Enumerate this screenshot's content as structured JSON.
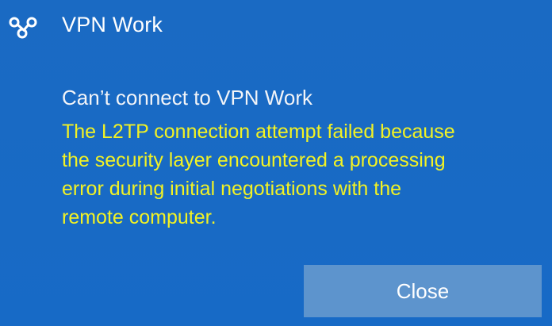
{
  "toast": {
    "app_title": "VPN Work",
    "icon": "vpn-link-icon",
    "message_title": "Can’t connect to VPN Work",
    "message_lines": [
      "The L2TP connection attempt failed because",
      "the security layer encountered a processing",
      "error during initial negotiations with the",
      "remote computer."
    ],
    "close_label": "Close"
  },
  "colors": {
    "background": "#1a6ac3",
    "title_text": "#ffffff",
    "error_text": "#f2f224",
    "button_bg": "#5d94cd"
  }
}
